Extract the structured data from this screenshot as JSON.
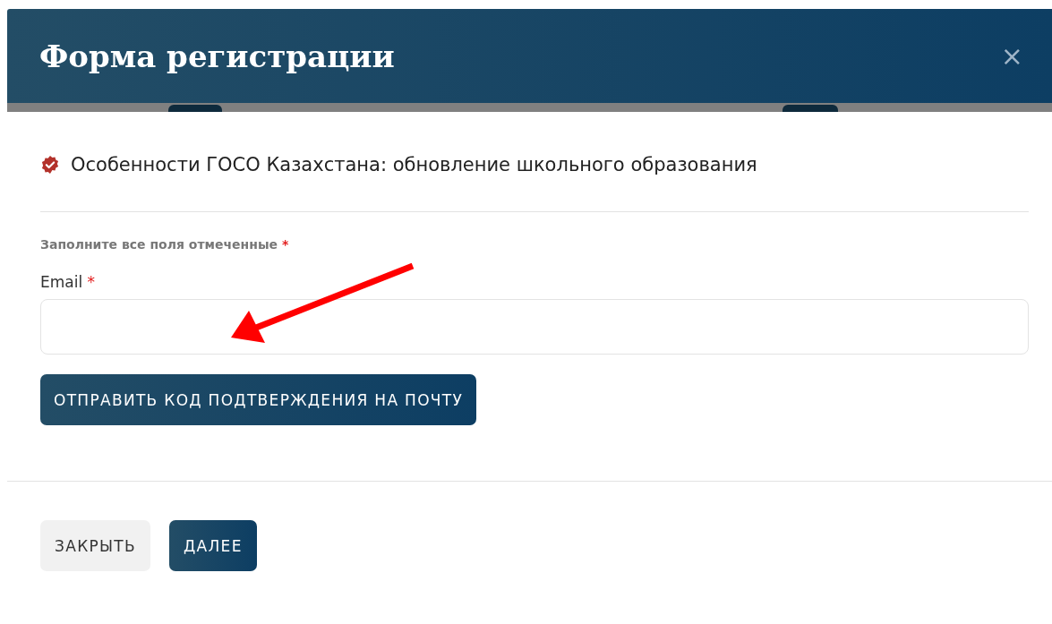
{
  "dialog": {
    "title": "Форма регистрации",
    "close_label": "×"
  },
  "course": {
    "title": "Особенности ГОСО Казахстана: обновление школьного образования",
    "verified": true
  },
  "note": {
    "text": "Заполните все поля отмеченные",
    "required_mark": "*"
  },
  "fields": [
    {
      "label": "Email",
      "required_mark": "*"
    }
  ],
  "send_code_button": "ОТПРАВИТЬ КОД ПОДТВЕРЖДЕНИЯ НА ПОЧТУ",
  "footer_buttons": [
    {
      "label": "ЗАКРЫТЬ",
      "kind": "secondary"
    },
    {
      "label": "ДАЛЕЕ",
      "kind": "primary"
    }
  ]
}
